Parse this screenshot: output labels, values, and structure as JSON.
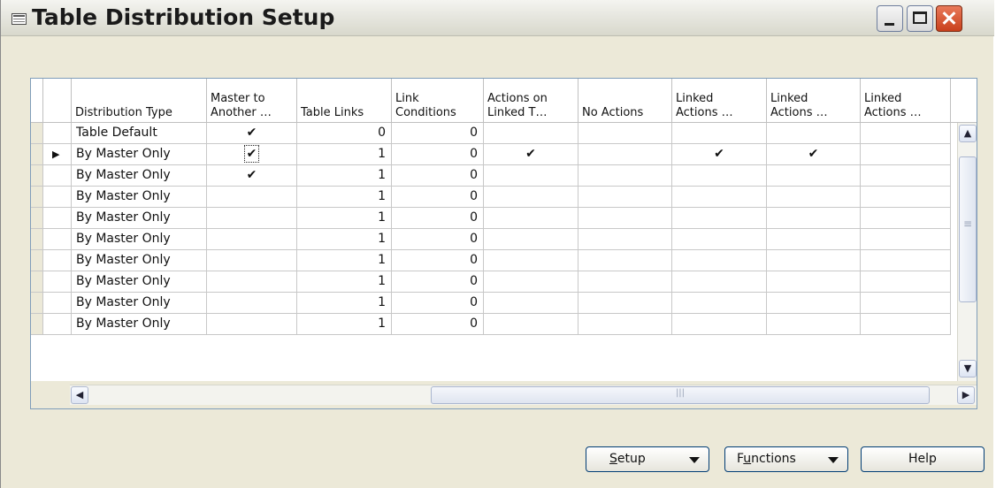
{
  "window": {
    "title": "Table Distribution Setup"
  },
  "grid": {
    "columns": [
      {
        "label_lines": [
          "Distribution Type"
        ]
      },
      {
        "label_lines": [
          "Master to",
          "Another …"
        ]
      },
      {
        "label_lines": [
          "Table Links"
        ]
      },
      {
        "label_lines": [
          "Link",
          "Conditions"
        ]
      },
      {
        "label_lines": [
          "Actions on",
          "Linked T…"
        ]
      },
      {
        "label_lines": [
          "No Actions"
        ]
      },
      {
        "label_lines": [
          "Linked",
          "Actions …"
        ]
      },
      {
        "label_lines": [
          "Linked",
          "Actions …"
        ]
      },
      {
        "label_lines": [
          "Linked",
          "Actions …"
        ]
      }
    ],
    "rows": [
      {
        "current": false,
        "type": "Table Default",
        "master": "✔",
        "table_links": "0",
        "link_conditions": "0",
        "actions_linked": "",
        "no_actions": "",
        "linked1": "",
        "linked2": "",
        "linked3": ""
      },
      {
        "current": true,
        "type": "By Master Only",
        "master": "✔",
        "table_links": "1",
        "link_conditions": "0",
        "actions_linked": "✔",
        "no_actions": "",
        "linked1": "✔",
        "linked2": "✔",
        "linked3": ""
      },
      {
        "current": false,
        "type": "By Master Only",
        "master": "✔",
        "table_links": "1",
        "link_conditions": "0",
        "actions_linked": "",
        "no_actions": "",
        "linked1": "",
        "linked2": "",
        "linked3": ""
      },
      {
        "current": false,
        "type": "By Master Only",
        "master": "",
        "table_links": "1",
        "link_conditions": "0",
        "actions_linked": "",
        "no_actions": "",
        "linked1": "",
        "linked2": "",
        "linked3": ""
      },
      {
        "current": false,
        "type": "By Master Only",
        "master": "",
        "table_links": "1",
        "link_conditions": "0",
        "actions_linked": "",
        "no_actions": "",
        "linked1": "",
        "linked2": "",
        "linked3": ""
      },
      {
        "current": false,
        "type": "By Master Only",
        "master": "",
        "table_links": "1",
        "link_conditions": "0",
        "actions_linked": "",
        "no_actions": "",
        "linked1": "",
        "linked2": "",
        "linked3": ""
      },
      {
        "current": false,
        "type": "By Master Only",
        "master": "",
        "table_links": "1",
        "link_conditions": "0",
        "actions_linked": "",
        "no_actions": "",
        "linked1": "",
        "linked2": "",
        "linked3": ""
      },
      {
        "current": false,
        "type": "By Master Only",
        "master": "",
        "table_links": "1",
        "link_conditions": "0",
        "actions_linked": "",
        "no_actions": "",
        "linked1": "",
        "linked2": "",
        "linked3": ""
      },
      {
        "current": false,
        "type": "By Master Only",
        "master": "",
        "table_links": "1",
        "link_conditions": "0",
        "actions_linked": "",
        "no_actions": "",
        "linked1": "",
        "linked2": "",
        "linked3": ""
      },
      {
        "current": false,
        "type": "By Master Only",
        "master": "",
        "table_links": "1",
        "link_conditions": "0",
        "actions_linked": "",
        "no_actions": "",
        "linked1": "",
        "linked2": "",
        "linked3": ""
      }
    ],
    "current_row_marker": "▶",
    "focused_cell": {
      "row": 1,
      "column": "master"
    }
  },
  "scrollbars": {
    "up": "▲",
    "down": "▼",
    "left": "◀",
    "right": "▶"
  },
  "footer": {
    "setup": {
      "pre": "",
      "accel": "S",
      "post": "etup"
    },
    "functions": {
      "pre": "F",
      "accel": "u",
      "post": "nctions"
    },
    "help": "Help"
  },
  "colors": {
    "window_bg": "#ECE9D8",
    "grid_border": "#7f9db9",
    "close_button": "#c9401c"
  }
}
